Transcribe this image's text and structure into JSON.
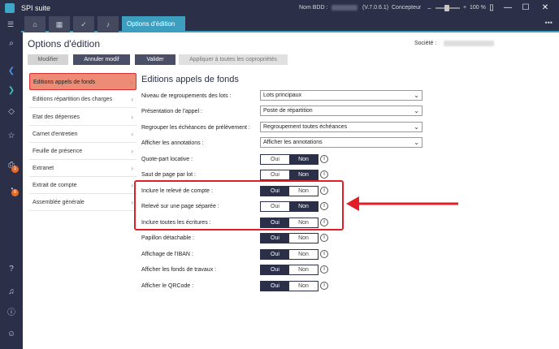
{
  "titlebar": {
    "app_title": "SPI suite",
    "db_label": "Nom BDD :",
    "version": "(V.7.0.6.1)",
    "role": "Concepteur",
    "zoom": "100 %"
  },
  "tabs": {
    "active_label": "Options d'édition",
    "icons": [
      "home-icon",
      "calendar-icon",
      "check-icon",
      "bell-icon"
    ]
  },
  "header": {
    "title": "Options d'édition",
    "societe_label": "Société :"
  },
  "toolbar": {
    "modifier": "Modifier",
    "annuler": "Annuler modif",
    "valider": "Valider",
    "appliquer": "Appliquer à toutes les copropriétés"
  },
  "sidebar": {
    "items": [
      {
        "label": "Editions appels de fonds"
      },
      {
        "label": "Editions répartition des charges"
      },
      {
        "label": "Etat des dépenses"
      },
      {
        "label": "Carnet d'entretien"
      },
      {
        "label": "Feuille de présence"
      },
      {
        "label": "Extranet"
      },
      {
        "label": "Extrait de compte"
      },
      {
        "label": "Assemblée générale"
      }
    ]
  },
  "section": {
    "title": "Editions appels de fonds"
  },
  "fields": {
    "niveau": {
      "label": "Niveau de regroupements des lots :",
      "value": "Lots principaux"
    },
    "presentation": {
      "label": "Présentation de l'appel :",
      "value": "Poste de répartition"
    },
    "regrouper": {
      "label": "Regrouper les échéances de prélèvement :",
      "value": "Regroupement toutes échéances"
    },
    "annotations": {
      "label": "Afficher les annotations :",
      "value": "Afficher les annotations"
    }
  },
  "toggles": [
    {
      "label": "Quote-part locative :",
      "selected": "Non"
    },
    {
      "label": "Saut de page par lot :",
      "selected": "Non"
    },
    {
      "label": "Inclure le relevé de compte :",
      "selected": "Oui"
    },
    {
      "label": "Relevé sur une page séparée :",
      "selected": "Non"
    },
    {
      "label": "Inclure toutes les écritures :",
      "selected": "Oui"
    },
    {
      "label": "Papillon détachable :",
      "selected": "Oui"
    },
    {
      "label": "Affichage de l'IBAN :",
      "selected": "Oui"
    },
    {
      "label": "Afficher les fonds de travaux :",
      "selected": "Oui"
    },
    {
      "label": "Afficher le QRCode :",
      "selected": "Oui"
    }
  ],
  "toggle_labels": {
    "oui": "Oui",
    "non": "Non"
  },
  "badges": {
    "print": "1",
    "timer": "8"
  },
  "colors": {
    "nav_bg": "#2b2f47",
    "accent": "#3c9fbf",
    "active_item": "#ec8c76",
    "highlight": "#e21f27"
  }
}
